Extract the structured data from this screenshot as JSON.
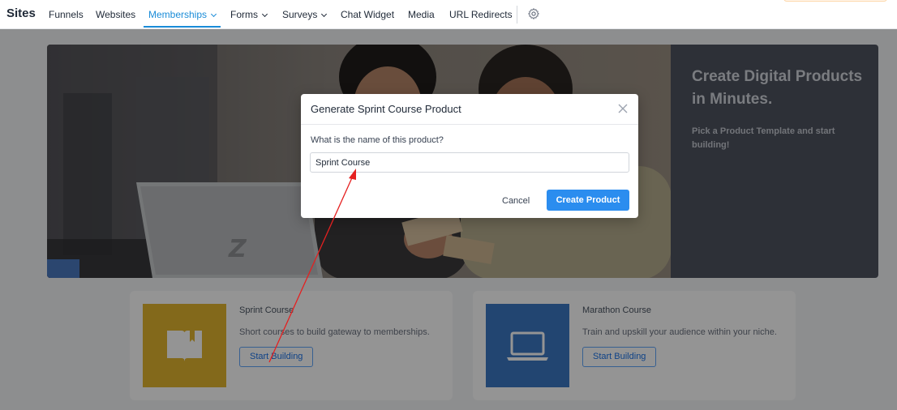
{
  "nav": {
    "brand": "Sites",
    "items": [
      {
        "label": "Funnels"
      },
      {
        "label": "Websites"
      },
      {
        "label": "Memberships",
        "active": true,
        "dropdown": true
      },
      {
        "label": "Forms",
        "dropdown": true
      },
      {
        "label": "Surveys",
        "dropdown": true
      },
      {
        "label": "Chat Widget"
      },
      {
        "label": "Media"
      },
      {
        "label": "URL Redirects"
      }
    ],
    "settings_icon": "gear-icon",
    "accent_color": "#1a8cd8"
  },
  "hero": {
    "heading": "Create Digital Products in Minutes.",
    "subtext": "Pick a Product Template and start building!",
    "panel_color": "#4f5460"
  },
  "cards": [
    {
      "title": "Sprint Course",
      "description": "Short courses to build gateway to memberships.",
      "button": "Start Building",
      "icon": "book-icon",
      "thumb_color": "#e2b52f"
    },
    {
      "title": "Marathon Course",
      "description": "Train and upskill your audience within your niche.",
      "button": "Start Building",
      "icon": "laptop-icon",
      "thumb_color": "#3b78c3"
    }
  ],
  "modal": {
    "title": "Generate Sprint Course Product",
    "label": "What is the name of this product?",
    "input_value": "Sprint Course",
    "cancel": "Cancel",
    "confirm": "Create Product",
    "close_icon": "close-icon",
    "confirm_color": "#2b8def"
  },
  "annotation": {
    "color": "#e52020"
  }
}
